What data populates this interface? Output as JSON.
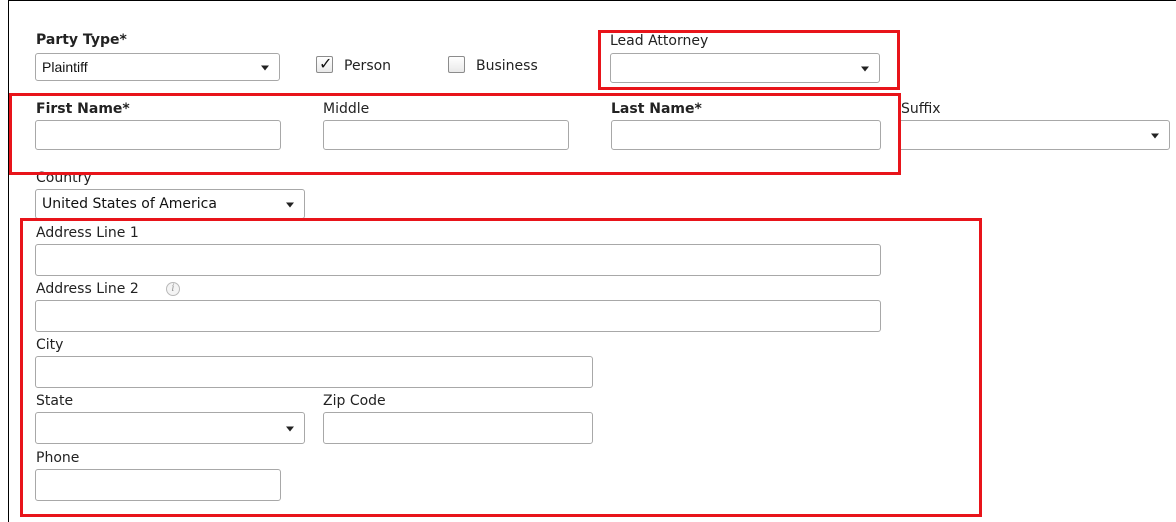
{
  "party_type": {
    "label": "Party Type*",
    "value": "Plaintiff",
    "person": {
      "label": "Person",
      "checked": true
    },
    "business": {
      "label": "Business",
      "checked": false
    }
  },
  "lead_attorney": {
    "label": "Lead Attorney",
    "value": ""
  },
  "name": {
    "first_label": "First Name*",
    "middle_label": "Middle",
    "last_label": "Last Name*",
    "suffix_label": "Suffix",
    "first_value": "",
    "middle_value": "",
    "last_value": "",
    "suffix_value": ""
  },
  "country": {
    "label": "Country",
    "value": "United States of America"
  },
  "address": {
    "line1_label": "Address Line 1",
    "line2_label": "Address Line 2",
    "city_label": "City",
    "state_label": "State",
    "zip_label": "Zip Code",
    "phone_label": "Phone",
    "info_glyph": "i"
  },
  "colors": {
    "highlight": "#e8141a",
    "border": "#a8a8a8"
  },
  "icons": [
    "chevron-down-icon",
    "checkmark-icon",
    "info-icon"
  ]
}
